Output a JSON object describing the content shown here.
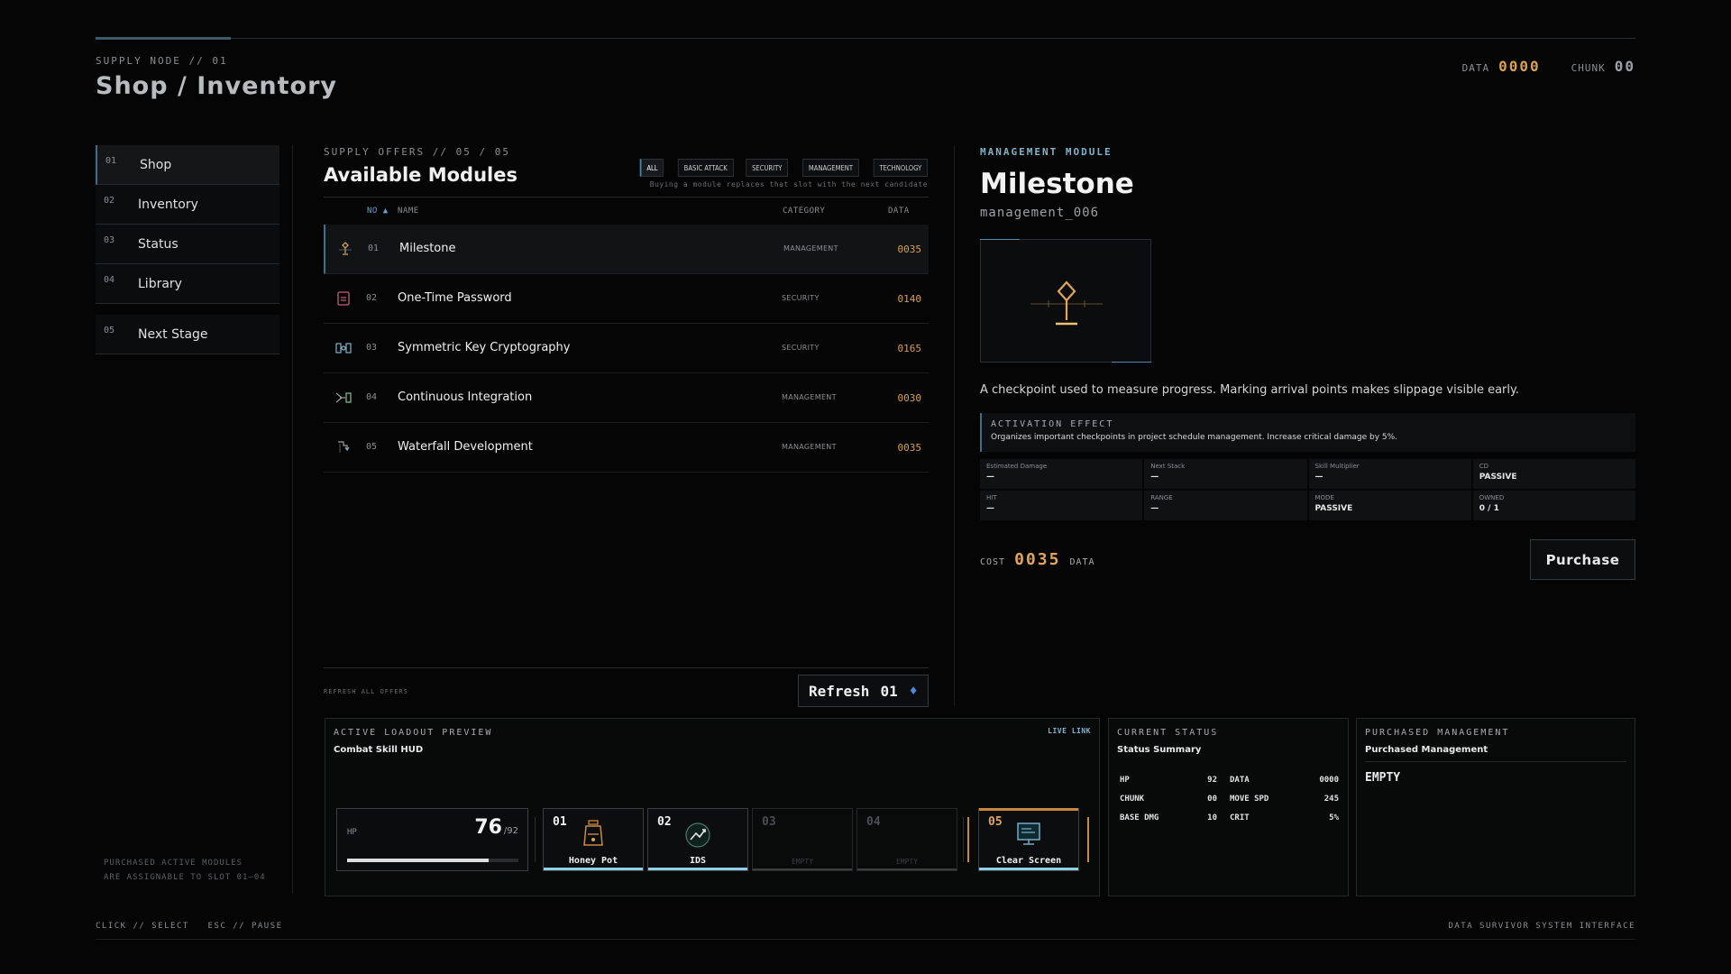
{
  "header": {
    "eyebrow": "SUPPLY NODE // 01",
    "title": "Shop / Inventory",
    "data_label": "DATA",
    "data_value": "0000",
    "chunk_label": "CHUNK",
    "chunk_value": "00"
  },
  "colors": {
    "accent": "#3d6f8a",
    "cost": "#d9a050",
    "highlight": "#7fb4cc"
  },
  "sidebar": {
    "items": [
      {
        "num": "01",
        "label": "Shop",
        "active": true
      },
      {
        "num": "02",
        "label": "Inventory"
      },
      {
        "num": "03",
        "label": "Status"
      },
      {
        "num": "04",
        "label": "Library"
      }
    ],
    "next": {
      "num": "05",
      "label": "Next Stage"
    },
    "note_line1": "PURCHASED ACTIVE MODULES",
    "note_line2": "ARE ASSIGNABLE TO SLOT 01–04"
  },
  "offers": {
    "eyebrow": "SUPPLY OFFERS // 05 / 05",
    "title": "Available Modules",
    "filters": [
      "ALL",
      "BASIC ATTACK",
      "SECURITY",
      "MANAGEMENT",
      "TECHNOLOGY"
    ],
    "active_filter": "ALL",
    "hint": "Buying a module replaces that slot with the next candidate",
    "columns": {
      "no": "NO ▲",
      "name": "NAME",
      "category": "CATEGORY",
      "data": "DATA"
    },
    "rows": [
      {
        "num": "01",
        "name": "Milestone",
        "category": "MANAGEMENT",
        "cost": "0035",
        "icon": "milestone-icon"
      },
      {
        "num": "02",
        "name": "One-Time Password",
        "category": "SECURITY",
        "cost": "0140",
        "icon": "otp-icon"
      },
      {
        "num": "03",
        "name": "Symmetric Key Cryptography",
        "category": "SECURITY",
        "cost": "0165",
        "icon": "key-crypto-icon"
      },
      {
        "num": "04",
        "name": "Continuous Integration",
        "category": "MANAGEMENT",
        "cost": "0030",
        "icon": "ci-icon"
      },
      {
        "num": "05",
        "name": "Waterfall Development",
        "category": "MANAGEMENT",
        "cost": "0035",
        "icon": "waterfall-icon"
      }
    ],
    "refresh_note": "REFRESH ALL OFFERS",
    "refresh_label": "Refresh",
    "refresh_count": "01",
    "refresh_glyph": "♦"
  },
  "detail": {
    "eyebrow": "MANAGEMENT MODULE",
    "title": "Milestone",
    "id": "management_006",
    "description": "A checkpoint used to measure progress. Marking arrival points makes slippage visible early.",
    "effect_header": "ACTIVATION EFFECT",
    "effect_text": "Organizes important checkpoints in project schedule management. Increase critical damage by 5%.",
    "stats": [
      {
        "k": "Estimated Damage",
        "v": "—"
      },
      {
        "k": "Next Stack",
        "v": "—"
      },
      {
        "k": "Skill Multiplier",
        "v": "—"
      },
      {
        "k": "CD",
        "v": "PASSIVE"
      },
      {
        "k": "HIT",
        "v": "—"
      },
      {
        "k": "RANGE",
        "v": "—"
      },
      {
        "k": "MODE",
        "v": "PASSIVE"
      },
      {
        "k": "OWNED",
        "v": "0 / 1"
      }
    ],
    "cost_label": "COST",
    "cost_value": "0035",
    "cost_unit": "DATA",
    "purchase_label": "Purchase"
  },
  "loadout": {
    "header": "ACTIVE LOADOUT PREVIEW",
    "sub": "Combat Skill HUD",
    "live": "LIVE LINK",
    "hp_label": "HP",
    "hp_current": "76",
    "hp_max": "/92",
    "hp_fraction": 0.826,
    "slots": [
      {
        "num": "01",
        "name": "Honey Pot",
        "icon": "honey-pot-icon"
      },
      {
        "num": "02",
        "name": "IDS",
        "icon": "ids-icon"
      },
      {
        "num": "03",
        "name": "EMPTY"
      },
      {
        "num": "04",
        "name": "EMPTY"
      },
      {
        "num": "05",
        "name": "Clear Screen",
        "icon": "clear-screen-icon"
      }
    ]
  },
  "status": {
    "header": "CURRENT STATUS",
    "sub": "Status Summary",
    "rows": [
      {
        "k": "HP",
        "v": "92",
        "k2": "DATA",
        "v2": "0000"
      },
      {
        "k": "CHUNK",
        "v": "00",
        "k2": "MOVE SPD",
        "v2": "245"
      },
      {
        "k": "BASE DMG",
        "v": "10",
        "k2": "CRIT",
        "v2": "5%"
      }
    ]
  },
  "management": {
    "header": "PURCHASED MANAGEMENT",
    "sub": "Purchased Management",
    "empty": "EMPTY"
  },
  "footer": {
    "left": "CLICK // SELECT   ESC // PAUSE",
    "right": "DATA SURVIVOR SYSTEM INTERFACE"
  }
}
